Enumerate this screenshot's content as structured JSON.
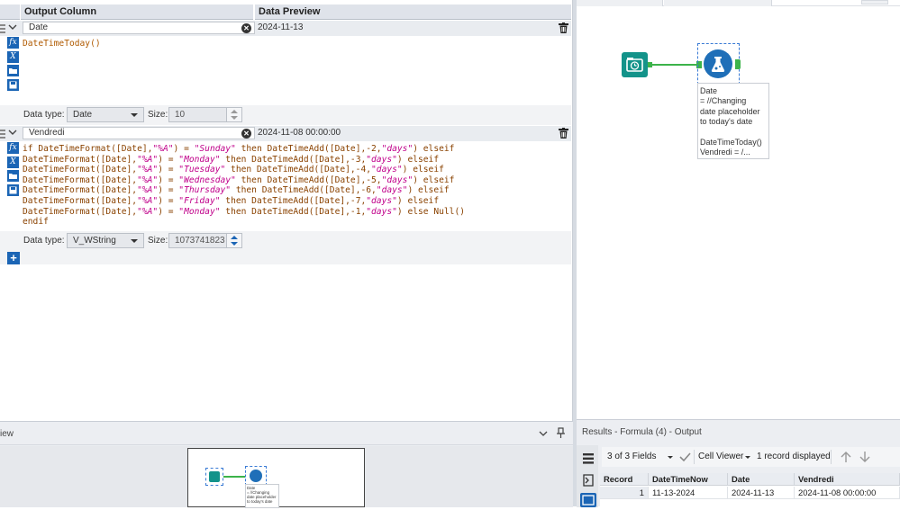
{
  "config": {
    "headers": {
      "output_column": "Output Column",
      "data_preview": "Data Preview"
    },
    "fields": [
      {
        "name": "Date",
        "preview": "2024-11-13",
        "expression_lines": [
          "DateTimeToday()"
        ],
        "data_type_label": "Data type:",
        "data_type": "Date",
        "size_label": "Size:",
        "size": "10"
      },
      {
        "name": "Vendredi",
        "preview": "2024-11-08 00:00:00",
        "expression_lines": [
          "if DateTimeFormat([Date],\"%A\") = \"Sunday\" then DateTimeAdd([Date],-2,\"days\") elseif",
          "DateTimeFormat([Date],\"%A\") = \"Monday\" then DateTimeAdd([Date],-3,\"days\") elseif",
          "DateTimeFormat([Date],\"%A\") = \"Tuesday\" then DateTimeAdd([Date],-4,\"days\") elseif",
          "DateTimeFormat([Date],\"%A\") = \"Wednesday\" then DateTimeAdd([Date],-5,\"days\") elseif",
          "DateTimeFormat([Date],\"%A\") = \"Thursday\" then DateTimeAdd([Date],-6,\"days\") elseif",
          "DateTimeFormat([Date],\"%A\") = \"Friday\" then DateTimeAdd([Date],-7,\"days\") elseif",
          "DateTimeFormat([Date],\"%A\") = \"Monday\" then DateTimeAdd([Date],-1,\"days\") else Null()",
          "endif"
        ],
        "data_type_label": "Data type:",
        "data_type": "V_WString",
        "size_label": "Size:",
        "size": "1073741823"
      }
    ],
    "add_button": "+",
    "expression_icons": [
      "fx",
      "X",
      "folder-icon",
      "save-icon"
    ]
  },
  "overview": {
    "title": "iew",
    "mini_annotation": [
      "Date",
      "= //Changing",
      "date placeholder",
      "to today's date"
    ]
  },
  "canvas": {
    "annotation": [
      "Date",
      "= //Changing",
      "date placeholder",
      "to today's date",
      "",
      "DateTimeToday()",
      "Vendredi = /..."
    ]
  },
  "results": {
    "title": "Results - Formula (4) - Output",
    "fields_selector": "3 of 3 Fields",
    "cell_viewer": "Cell Viewer",
    "record_count": "1 record displayed",
    "columns": [
      "Record",
      "DateTimeNow",
      "Date",
      "Vendredi"
    ],
    "rows": [
      [
        "1",
        "11-13-2024",
        "2024-11-13",
        "2024-11-08 00:00:00"
      ]
    ]
  },
  "colors": {
    "accent": "#1b65b5",
    "tool_teal": "#13938a",
    "tool_blue": "#1f6fb8",
    "connector_green": "#3cb34a"
  }
}
